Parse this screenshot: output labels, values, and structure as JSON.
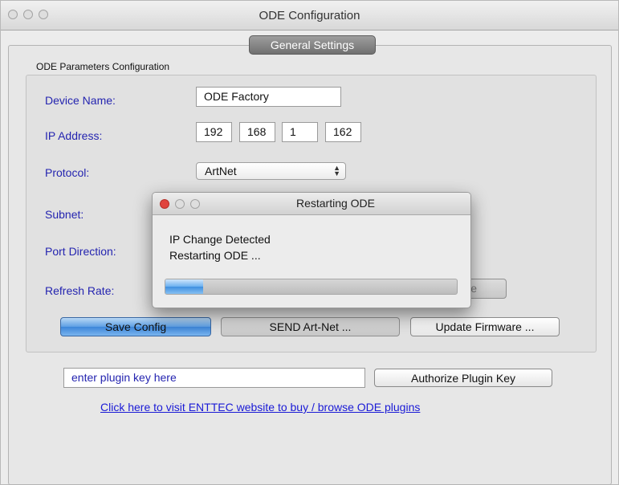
{
  "window": {
    "title": "ODE Configuration"
  },
  "tabs": [
    {
      "label": "General Settings",
      "selected": true
    }
  ],
  "group": {
    "title": "ODE Parameters Configuration",
    "fields": {
      "device_name": {
        "label": "Device Name:",
        "value": "ODE Factory"
      },
      "ip_address": {
        "label": "IP Address:",
        "octets": [
          "192",
          "168",
          "1",
          "162"
        ]
      },
      "protocol": {
        "label": "Protocol:",
        "selected": "ArtNet"
      },
      "subnet": {
        "label": "Subnet:"
      },
      "port_direction": {
        "label": "Port Direction:"
      },
      "refresh_rate": {
        "label": "Refresh Rate:"
      }
    },
    "buttons": {
      "save": "Save Config",
      "send": "SEND Art-Net ...",
      "update": "Update Firmware ...",
      "hidden_partial": "e"
    }
  },
  "plugin": {
    "key_input_value": "enter plugin key here",
    "authorize_label": "Authorize Plugin Key",
    "link_text": " Click here to visit ENTTEC website to buy / browse ODE plugins "
  },
  "dialog": {
    "title": "Restarting ODE",
    "line1": "IP Change Detected",
    "line2": "Restarting ODE ...",
    "progress": 0.13
  },
  "colors": {
    "label_blue": "#2424b0",
    "link_blue": "#1a1ad6",
    "accent_blue": "#3d86d9",
    "close_red": "#e0443e"
  }
}
